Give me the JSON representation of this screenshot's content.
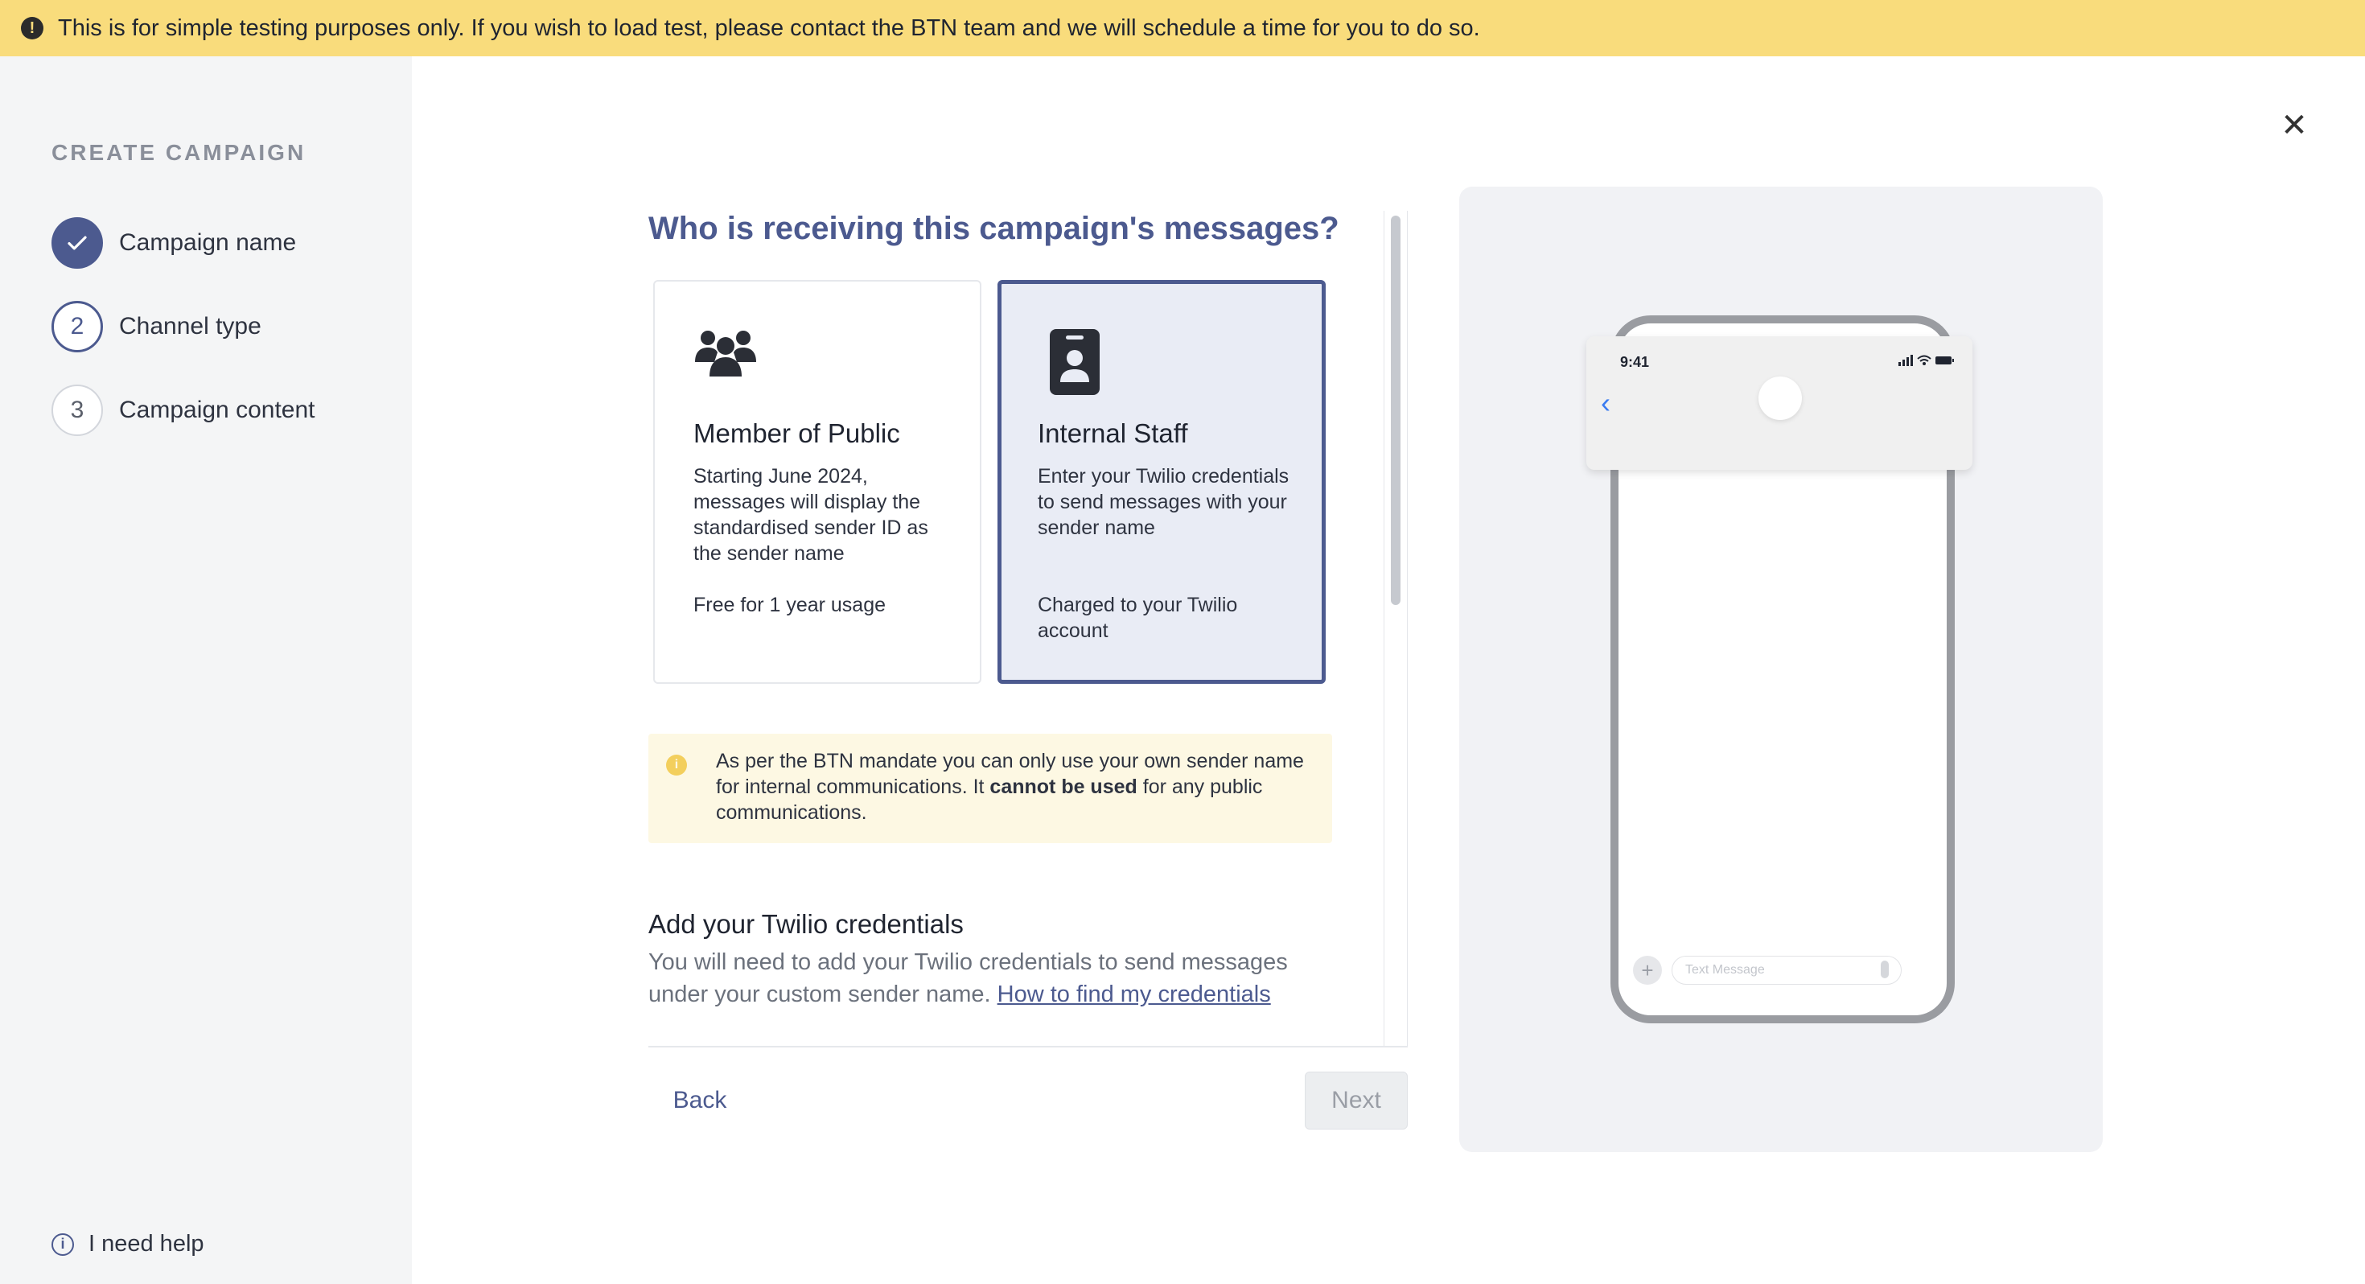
{
  "banner": {
    "icon": "exclamation-circle-icon",
    "text": "This is for simple testing purposes only. If you wish to load test, please contact the BTN team and we will schedule a time for you to do so."
  },
  "sidebar": {
    "title": "CREATE CAMPAIGN",
    "steps": [
      {
        "number": "",
        "label": "Campaign name",
        "status": "done",
        "icon": "check-icon"
      },
      {
        "number": "2",
        "label": "Channel type",
        "status": "active"
      },
      {
        "number": "3",
        "label": "Campaign content",
        "status": "todo"
      }
    ],
    "help": {
      "icon": "info-icon",
      "label": "I need help"
    }
  },
  "close": {
    "icon": "close-icon",
    "label": "✕"
  },
  "main": {
    "question": "Who is receiving this campaign's messages?",
    "options": [
      {
        "icon": "people-group-icon",
        "title": "Member of Public",
        "description": "Starting June 2024, messages will display the standardised sender ID as the sender name",
        "footer": "Free for 1 year usage",
        "selected": false
      },
      {
        "icon": "id-badge-icon",
        "title": "Internal Staff",
        "description": "Enter your Twilio credentials to send messages with your sender name",
        "footer": "Charged to your Twilio account",
        "selected": true
      }
    ],
    "notice": {
      "icon": "info-icon",
      "text_before": "As per the BTN mandate you can only use your own sender name for internal communications. It ",
      "text_bold": "cannot be used",
      "text_after": " for any public communications."
    },
    "credentials": {
      "title": "Add your Twilio credentials",
      "description": "You will need to add your Twilio credentials to send messages under your custom sender name. ",
      "link": "How to find my credentials"
    }
  },
  "footer": {
    "back_label": "Back",
    "next_label": "Next"
  },
  "preview": {
    "time": "9:41",
    "back_icon": "chevron-left-icon",
    "input_placeholder": "Text Message",
    "plus_label": "+"
  },
  "colors": {
    "accent": "#4c5a8f",
    "banner": "#f9dc7c",
    "selected_card_bg": "#e9ecf5",
    "notice_bg": "#fdf8e3"
  }
}
